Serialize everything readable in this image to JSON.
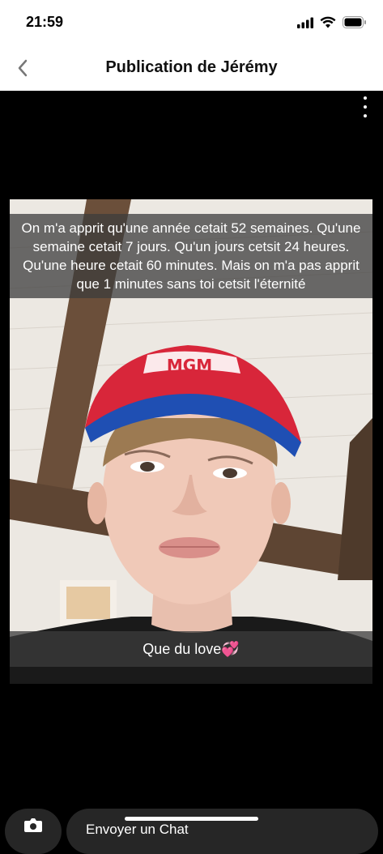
{
  "status": {
    "time": "21:59"
  },
  "header": {
    "title": "Publication de Jérémy"
  },
  "post": {
    "caption_top": "On m'a apprit qu'une année cetait 52 semaines. Qu'une semaine cetait 7 jours. Qu'un jours cetsit 24 heures. Qu'une heure cetait 60 minutes. Mais on m'a pas apprit que 1 minutes sans toi cetsit l'éternité",
    "caption_bottom": "Que du love💞",
    "cap_logo_text": "MGM"
  },
  "footer": {
    "chat_placeholder": "Envoyer un Chat"
  },
  "colors": {
    "cap_red": "#d8263a",
    "cap_blue": "#1f4fb3",
    "caption_bg": "#3c3c3c"
  }
}
